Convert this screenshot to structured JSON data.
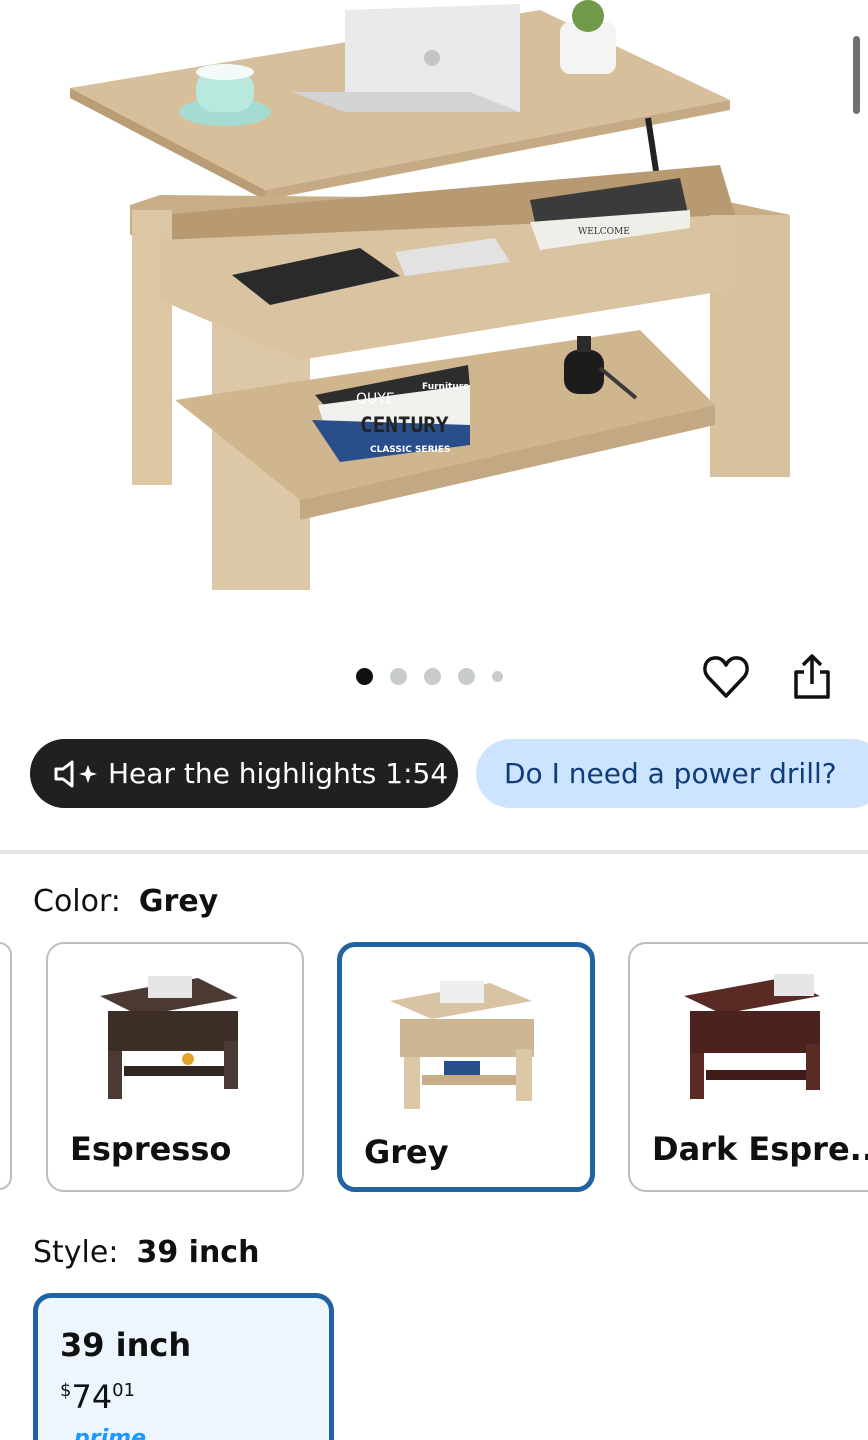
{
  "product_image": {
    "alt": "Lift-top coffee table in grey oak finish",
    "book_spine_1": "QUYE",
    "book_spine_brand": "Furniture",
    "book_spine_2": "CENTURY",
    "book_spine_3": "CLASSIC SERIES",
    "book_top": "WELCOME"
  },
  "carousel": {
    "total": 5,
    "active_index": 0
  },
  "actions": {
    "favorite": "heart-icon",
    "share": "share-icon"
  },
  "highlights_pill": {
    "label": "Hear the highlights 1:54"
  },
  "question_pill": {
    "label": "Do I need a power drill?"
  },
  "color": {
    "label": "Color:",
    "value": "Grey",
    "options": [
      "Espresso",
      "Grey",
      "Dark Espre..."
    ],
    "selected": "Grey",
    "swatch_colors": {
      "espresso": "#4a3a33",
      "grey": "#d8c3a3",
      "dark_espresso": "#5a2a24"
    }
  },
  "style": {
    "label": "Style:",
    "value": "39 inch",
    "options": [
      {
        "name": "39 inch",
        "currency": "$",
        "whole": "74",
        "fraction": "01",
        "badge": "prime"
      }
    ]
  },
  "colors": {
    "accent_blue": "#2162a1",
    "pill_dark": "#202020",
    "pill_light": "#cde4ff"
  }
}
